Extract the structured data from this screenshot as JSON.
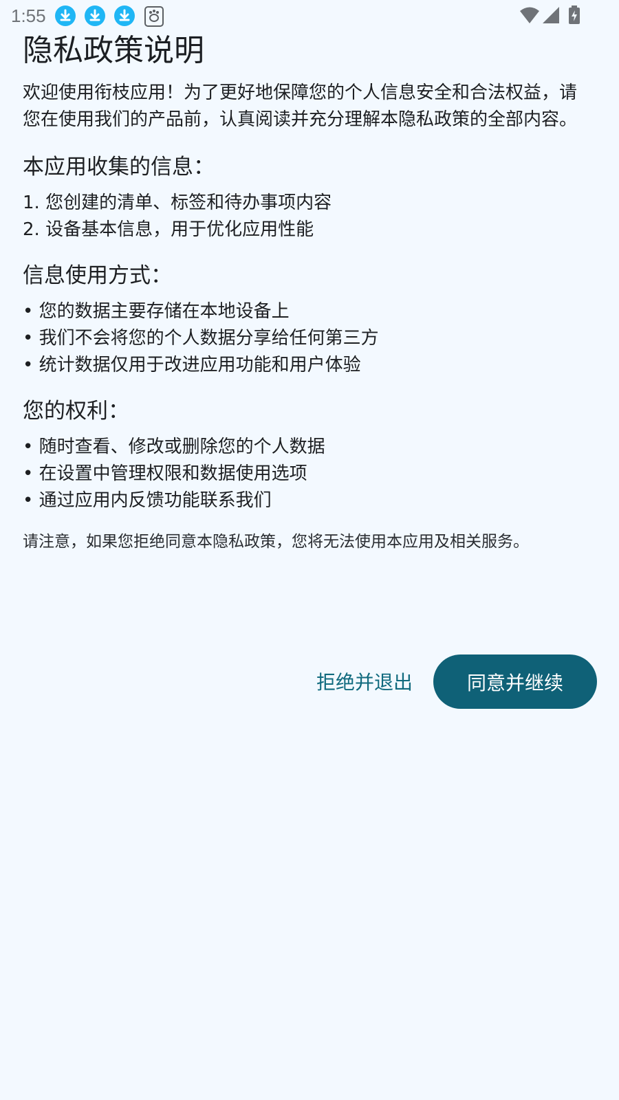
{
  "status_bar": {
    "time": "1:55",
    "notification_icons": [
      "download-icon",
      "download-icon",
      "download-icon",
      "baidu-icon"
    ],
    "system_icons": [
      "wifi-icon",
      "signal-icon",
      "battery-charging-icon"
    ]
  },
  "dialog": {
    "title": "隐私政策说明",
    "intro": "欢迎使用衔枝应用！为了更好地保障您的个人信息安全和合法权益，请您在使用我们的产品前，认真阅读并充分理解本隐私政策的全部内容。",
    "sections": [
      {
        "heading": "本应用收集的信息：",
        "items": [
          "1. 您创建的清单、标签和待办事项内容",
          "2. 设备基本信息，用于优化应用性能"
        ]
      },
      {
        "heading": "信息使用方式：",
        "items": [
          "• 您的数据主要存储在本地设备上",
          "• 我们不会将您的个人数据分享给任何第三方",
          "• 统计数据仅用于改进应用功能和用户体验"
        ]
      },
      {
        "heading": "您的权利：",
        "items": [
          "• 随时查看、修改或删除您的个人数据",
          "• 在设置中管理权限和数据使用选项",
          "• 通过应用内反馈功能联系我们"
        ]
      }
    ],
    "notice": "请注意，如果您拒绝同意本隐私政策，您将无法使用本应用及相关服务。",
    "decline_label": "拒绝并退出",
    "agree_label": "同意并继续"
  },
  "colors": {
    "background": "#f3f9ff",
    "accent": "#0f6177",
    "text_button": "#106a7e",
    "notification_blue": "#1fb6f5"
  }
}
